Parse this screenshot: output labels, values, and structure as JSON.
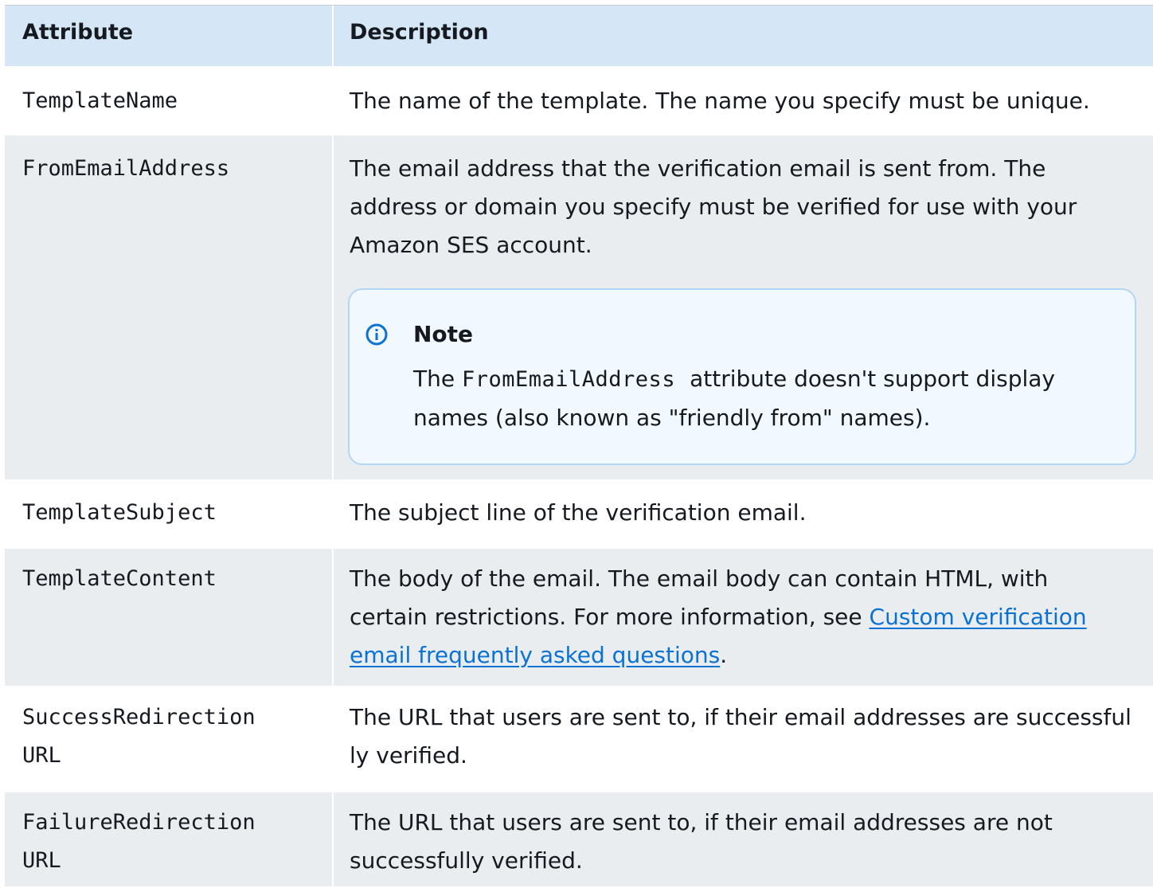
{
  "header": {
    "attribute": "Attribute",
    "description": "Description"
  },
  "rows": [
    {
      "attribute": "TemplateName",
      "description": "The name of the template. The name you specify must be unique."
    },
    {
      "attribute": "FromEmailAddress",
      "description": "The email address that the verification email is sent from. The address or domain you specify must be verified for use with your Amazon SES account.",
      "note": {
        "title": "Note",
        "icon": "info-icon",
        "text_before": "The ",
        "code": "FromEmailAddress",
        "text_after": "attribute doesn't support display names (also known as \"friendly from\" names)."
      }
    },
    {
      "attribute": "TemplateSubject",
      "description": "The subject line of the verification email."
    },
    {
      "attribute": "TemplateContent",
      "description_before": "The body of the email. The email body can contain HTML, with certain restrictions. For more information, see ",
      "link_text": "Custom verification email frequently asked questions",
      "description_after": "."
    },
    {
      "attribute_line1": "SuccessRedirection",
      "attribute_line2": "URL",
      "description": "The URL that users are sent to, if their email addresses are successfully verified."
    },
    {
      "attribute_line1": "FailureRedirection",
      "attribute_line2": "URL",
      "description": "The URL that users are sent to, if their email addresses are not successfully verified."
    }
  ],
  "colors": {
    "header_bg": "#d5e6f7",
    "alt_row_bg": "#eaedef",
    "note_bg": "#f1f8ff",
    "note_border": "#b3d6f5",
    "link": "#0972d3",
    "info_icon": "#0972d3"
  }
}
